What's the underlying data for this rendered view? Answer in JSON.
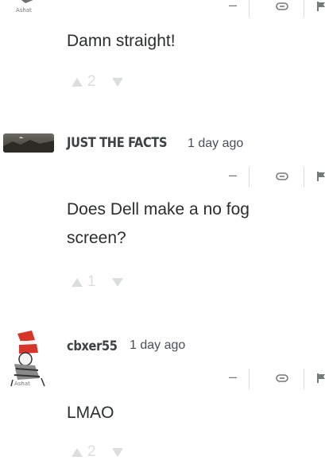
{
  "comments": [
    {
      "author": "",
      "time": "",
      "body": "Damn straight!",
      "upvotes": "2",
      "avatar_caption": "Ashat"
    },
    {
      "author": "JUST THE FACTS",
      "time": "1 day ago",
      "body": "Does Dell make a no fog screen?",
      "upvotes": "1"
    },
    {
      "author": "cbxer55",
      "time": "1 day ago",
      "body": "LMAO",
      "upvotes": "2",
      "avatar_caption": "Ashat"
    }
  ],
  "actions": {
    "collapse_label": "–"
  },
  "colors": {
    "text": "#2a2e2e",
    "muted": "#757a7a",
    "vote_disabled": "#dadede"
  },
  "icons": [
    "link-icon",
    "flag-icon",
    "upvote-icon",
    "downvote-icon"
  ]
}
